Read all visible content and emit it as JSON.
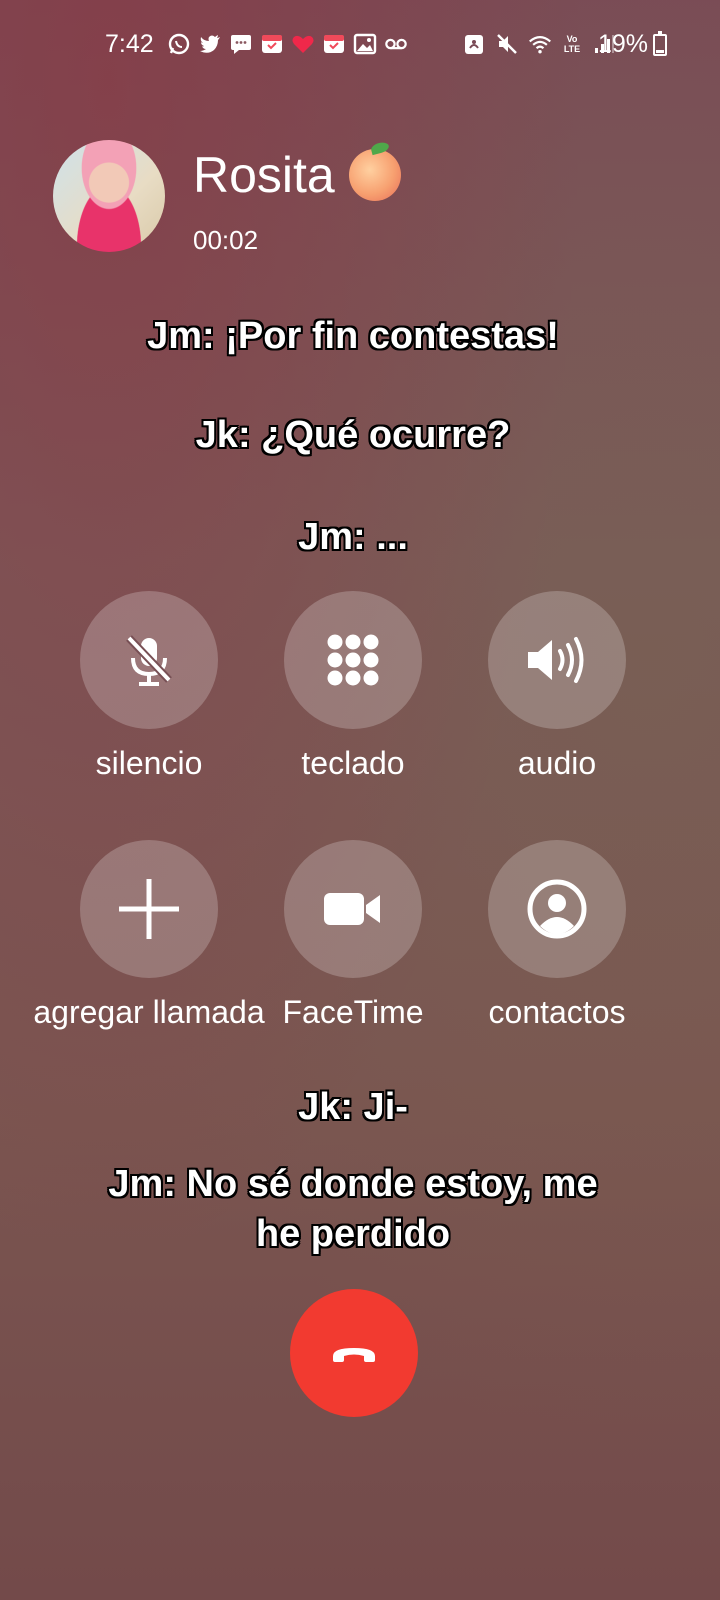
{
  "status_bar": {
    "time": "7:42",
    "notification_icons": [
      "whatsapp-icon",
      "twitter-icon",
      "message-icon",
      "calendar-icon",
      "heart-icon",
      "calendar-icon",
      "gallery-icon",
      "voicemail-icon"
    ],
    "system_icons": [
      "nfc-icon",
      "mute-icon",
      "wifi-icon",
      "volte-icon",
      "signal-icon"
    ],
    "volte_text": "Vo LTE",
    "battery_percent": "19%",
    "battery_level": 0.19
  },
  "caller": {
    "name": "Rosita",
    "emoji": "peach",
    "timer": "00:02"
  },
  "transcript_top": [
    "Jm: ¡Por fin contestas!",
    "Jk: ¿Qué ocurre?",
    "Jm: ..."
  ],
  "controls": [
    {
      "label": "silencio",
      "icon": "mute-microphone-icon"
    },
    {
      "label": "teclado",
      "icon": "keypad-icon"
    },
    {
      "label": "audio",
      "icon": "speaker-icon"
    },
    {
      "label": "agregar llamada",
      "icon": "plus-icon"
    },
    {
      "label": "FaceTime",
      "icon": "video-camera-icon"
    },
    {
      "label": "contactos",
      "icon": "contact-icon"
    }
  ],
  "transcript_bottom": [
    "Jk: Ji-",
    "Jm: No sé donde estoy, me",
    "he perdido"
  ],
  "colors": {
    "hangup": "#f23a30",
    "button_fill": "rgba(255,255,255,0.22)"
  }
}
